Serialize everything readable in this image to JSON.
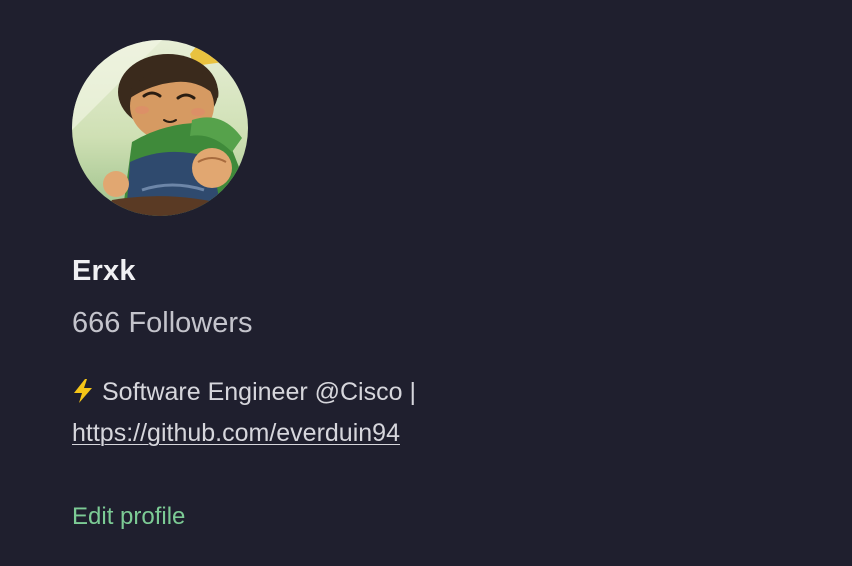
{
  "profile": {
    "avatar_alt": "avatar",
    "name": "Erxk",
    "followers_count": "666",
    "followers_label": "Followers",
    "bio_icon": "lightning-bolt-icon",
    "bio_text": "Software Engineer @Cisco |",
    "bio_link": "https://github.com/everduin94",
    "edit_profile_label": "Edit profile"
  },
  "colors": {
    "background": "#1f1f2e",
    "accent_green": "#7ccb95",
    "text_primary": "#f0f0f3",
    "text_secondary": "#c4c4cc",
    "bolt_yellow": "#f5c518"
  }
}
